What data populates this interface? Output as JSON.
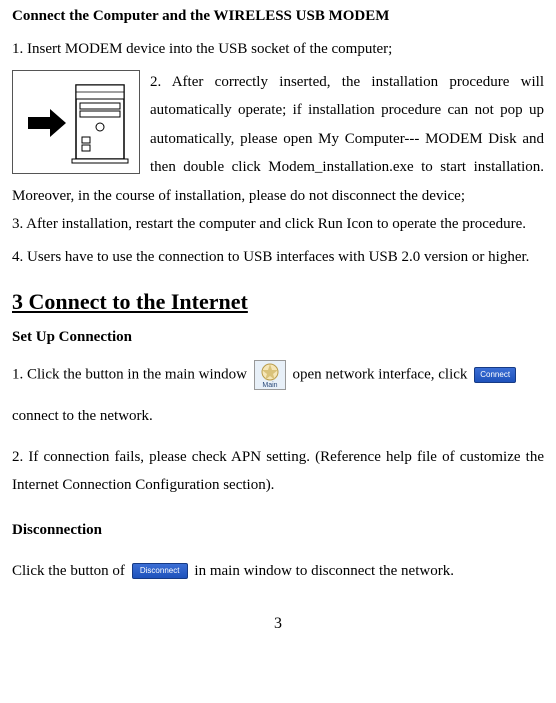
{
  "doc": {
    "section1_title": "Connect the Computer and the WIRELESS USB MODEM",
    "step1": "1. Insert MODEM device into the USB socket of the computer;",
    "step2": "2. After correctly inserted, the installation procedure will automatically operate; if installation procedure can not pop up automatically, please open My Computer--- MODEM Disk and then double click Modem_installation.exe to start installation. Moreover, in the course of installation, please do not disconnect the device;",
    "step3": "3. After installation, restart the computer and click Run Icon to operate the procedure.",
    "step4": "4. Users have to use the connection to USB interfaces with USB 2.0 version or higher.",
    "section2_title": "3 Connect to the Internet                                       ",
    "setup_heading": "Set Up Connection",
    "setup_p1_a": "1. Click the button in the main window ",
    "setup_p1_b": " open network interface, click ",
    "setup_p1_c": "connect to the network.",
    "setup_p2": "2. If connection fails, please check APN setting. (Reference help file of customize the Internet Connection Configuration section).",
    "disc_heading": "Disconnection",
    "disc_p1_a": "Click the button of ",
    "disc_p1_b": " in main window to disconnect the network.",
    "btn_connect": "Connect",
    "btn_disconnect": "Disconnect",
    "icon_main_label": "Main",
    "page_number": "3"
  }
}
